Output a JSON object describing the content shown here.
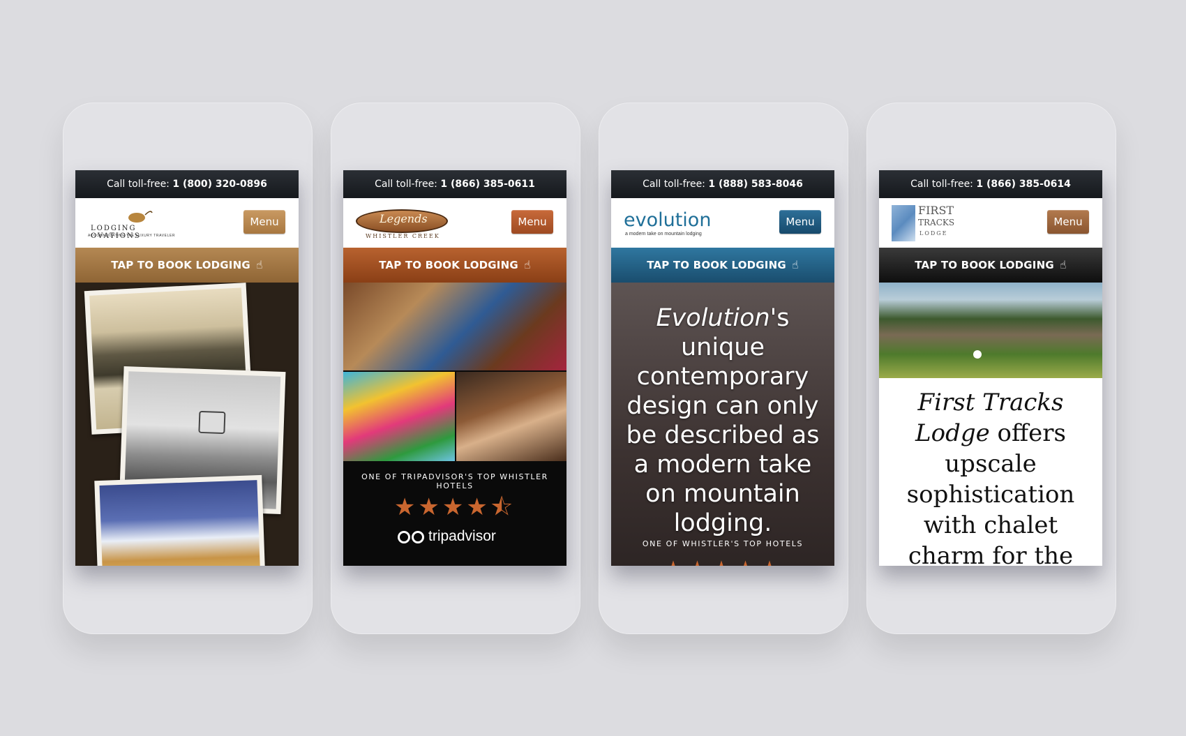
{
  "phones": [
    {
      "topbar_prefix": "Call toll-free: ",
      "phone_number": "1 (800) 320-0896",
      "logo_text": "LODGING OVATIONS",
      "logo_tagline": "ACCOMMODATING THE LUXURY TRAVELER",
      "menu_label": "Menu",
      "book_label": "TAP TO BOOK LODGING",
      "accent": "#a87740"
    },
    {
      "topbar_prefix": "Call toll-free: ",
      "phone_number": "1 (866) 385-0611",
      "logo_text": "Legends",
      "logo_tagline": "WHISTLER CREEK",
      "menu_label": "Menu",
      "book_label": "TAP TO BOOK LODGING",
      "caption": "ONE OF TRIPADVISOR'S TOP WHISTLER HOTELS",
      "rating_stars": 4.5,
      "brand": "tripadvisor",
      "accent": "#9e4a22"
    },
    {
      "topbar_prefix": "Call toll-free: ",
      "phone_number": "1 (888) 583-8046",
      "logo_text": "evolution",
      "logo_tagline": "a modern take on mountain lodging",
      "menu_label": "Menu",
      "book_label": "TAP TO BOOK LODGING",
      "headline_em": "Evolution",
      "headline_rest": "'s unique contemporary design can only be described as a modern take on mountain lodging.",
      "caption": "ONE OF WHISTLER'S TOP HOTELS",
      "accent": "#174a6c"
    },
    {
      "topbar_prefix": "Call toll-free: ",
      "phone_number": "1 (866) 385-0614",
      "logo_text_1": "FIRST",
      "logo_text_2": "TRACKS",
      "logo_text_3": "LODGE",
      "menu_label": "Menu",
      "book_label": "TAP TO BOOK LODGING",
      "headline_em": "First Tracks Lodge",
      "headline_rest": "offers upscale sophistication with chalet charm for the most discerning of",
      "accent": "#8a5530"
    }
  ]
}
